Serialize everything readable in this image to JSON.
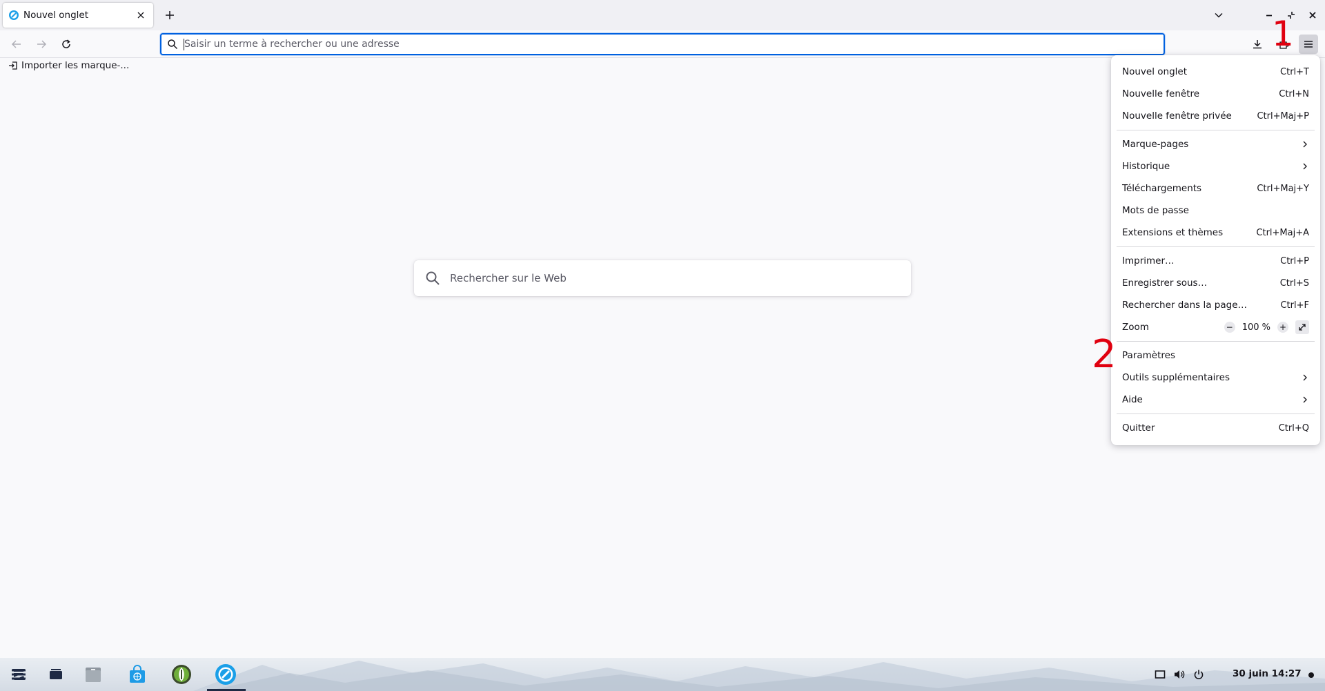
{
  "tab": {
    "title": "Nouvel onglet"
  },
  "urlbar": {
    "placeholder": "Saisir un terme à rechercher ou une adresse"
  },
  "bookmarks": {
    "import_label": "Importer les marque-..."
  },
  "content_search": {
    "placeholder": "Rechercher sur le Web"
  },
  "menu": {
    "new_tab": {
      "label": "Nouvel onglet",
      "shortcut": "Ctrl+T"
    },
    "new_window": {
      "label": "Nouvelle fenêtre",
      "shortcut": "Ctrl+N"
    },
    "new_private": {
      "label": "Nouvelle fenêtre privée",
      "shortcut": "Ctrl+Maj+P"
    },
    "bookmarks": {
      "label": "Marque-pages"
    },
    "history": {
      "label": "Historique"
    },
    "downloads": {
      "label": "Téléchargements",
      "shortcut": "Ctrl+Maj+Y"
    },
    "passwords": {
      "label": "Mots de passe"
    },
    "addons": {
      "label": "Extensions et thèmes",
      "shortcut": "Ctrl+Maj+A"
    },
    "print": {
      "label": "Imprimer…",
      "shortcut": "Ctrl+P"
    },
    "save_as": {
      "label": "Enregistrer sous…",
      "shortcut": "Ctrl+S"
    },
    "find": {
      "label": "Rechercher dans la page…",
      "shortcut": "Ctrl+F"
    },
    "zoom": {
      "label": "Zoom",
      "minus": "−",
      "value": "100 %",
      "plus": "+"
    },
    "settings": {
      "label": "Paramètres"
    },
    "more_tools": {
      "label": "Outils supplémentaires"
    },
    "help": {
      "label": "Aide"
    },
    "quit": {
      "label": "Quitter",
      "shortcut": "Ctrl+Q"
    }
  },
  "annotations": {
    "one": "1",
    "two": "2"
  },
  "taskbar": {
    "clock": "30 juin  14:27"
  },
  "colors": {
    "accent": "#0061e0",
    "annotation": "#e0000f"
  }
}
